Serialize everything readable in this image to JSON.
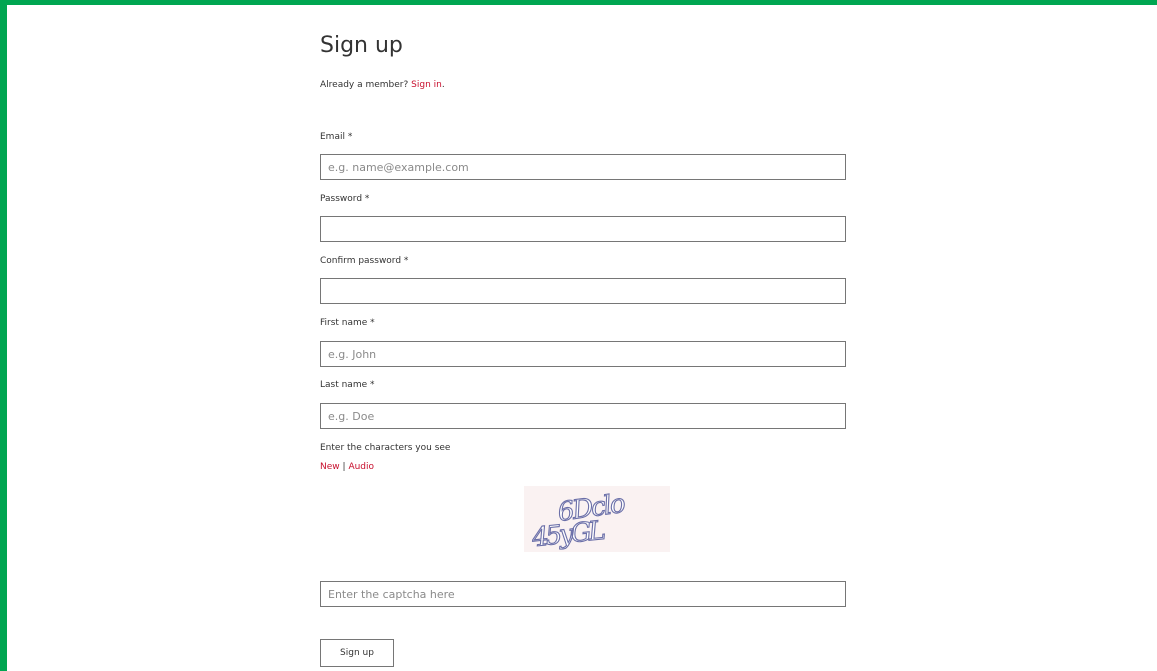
{
  "page": {
    "title": "Sign up",
    "already_member_text": "Already a member?",
    "sign_in_link": "Sign in",
    "sign_in_suffix": "."
  },
  "form": {
    "email": {
      "label": "Email *",
      "placeholder": "e.g. name@example.com",
      "value": ""
    },
    "password": {
      "label": "Password *",
      "value": ""
    },
    "confirm_password": {
      "label": "Confirm password *",
      "value": ""
    },
    "first_name": {
      "label": "First name *",
      "placeholder": "e.g. John",
      "value": ""
    },
    "last_name": {
      "label": "Last name *",
      "placeholder": "e.g. Doe",
      "value": ""
    }
  },
  "captcha": {
    "prompt": "Enter the characters you see",
    "new_link": "New",
    "separator": "|",
    "audio_link": "Audio",
    "image_text_line1": "6Dclo",
    "image_text_line2": "45yGL",
    "input_placeholder": "Enter the captcha here"
  },
  "submit": {
    "label": "Sign up"
  },
  "colors": {
    "frame": "#00a651",
    "link": "#c8102e",
    "captcha_ink": "#6b6fa8"
  }
}
